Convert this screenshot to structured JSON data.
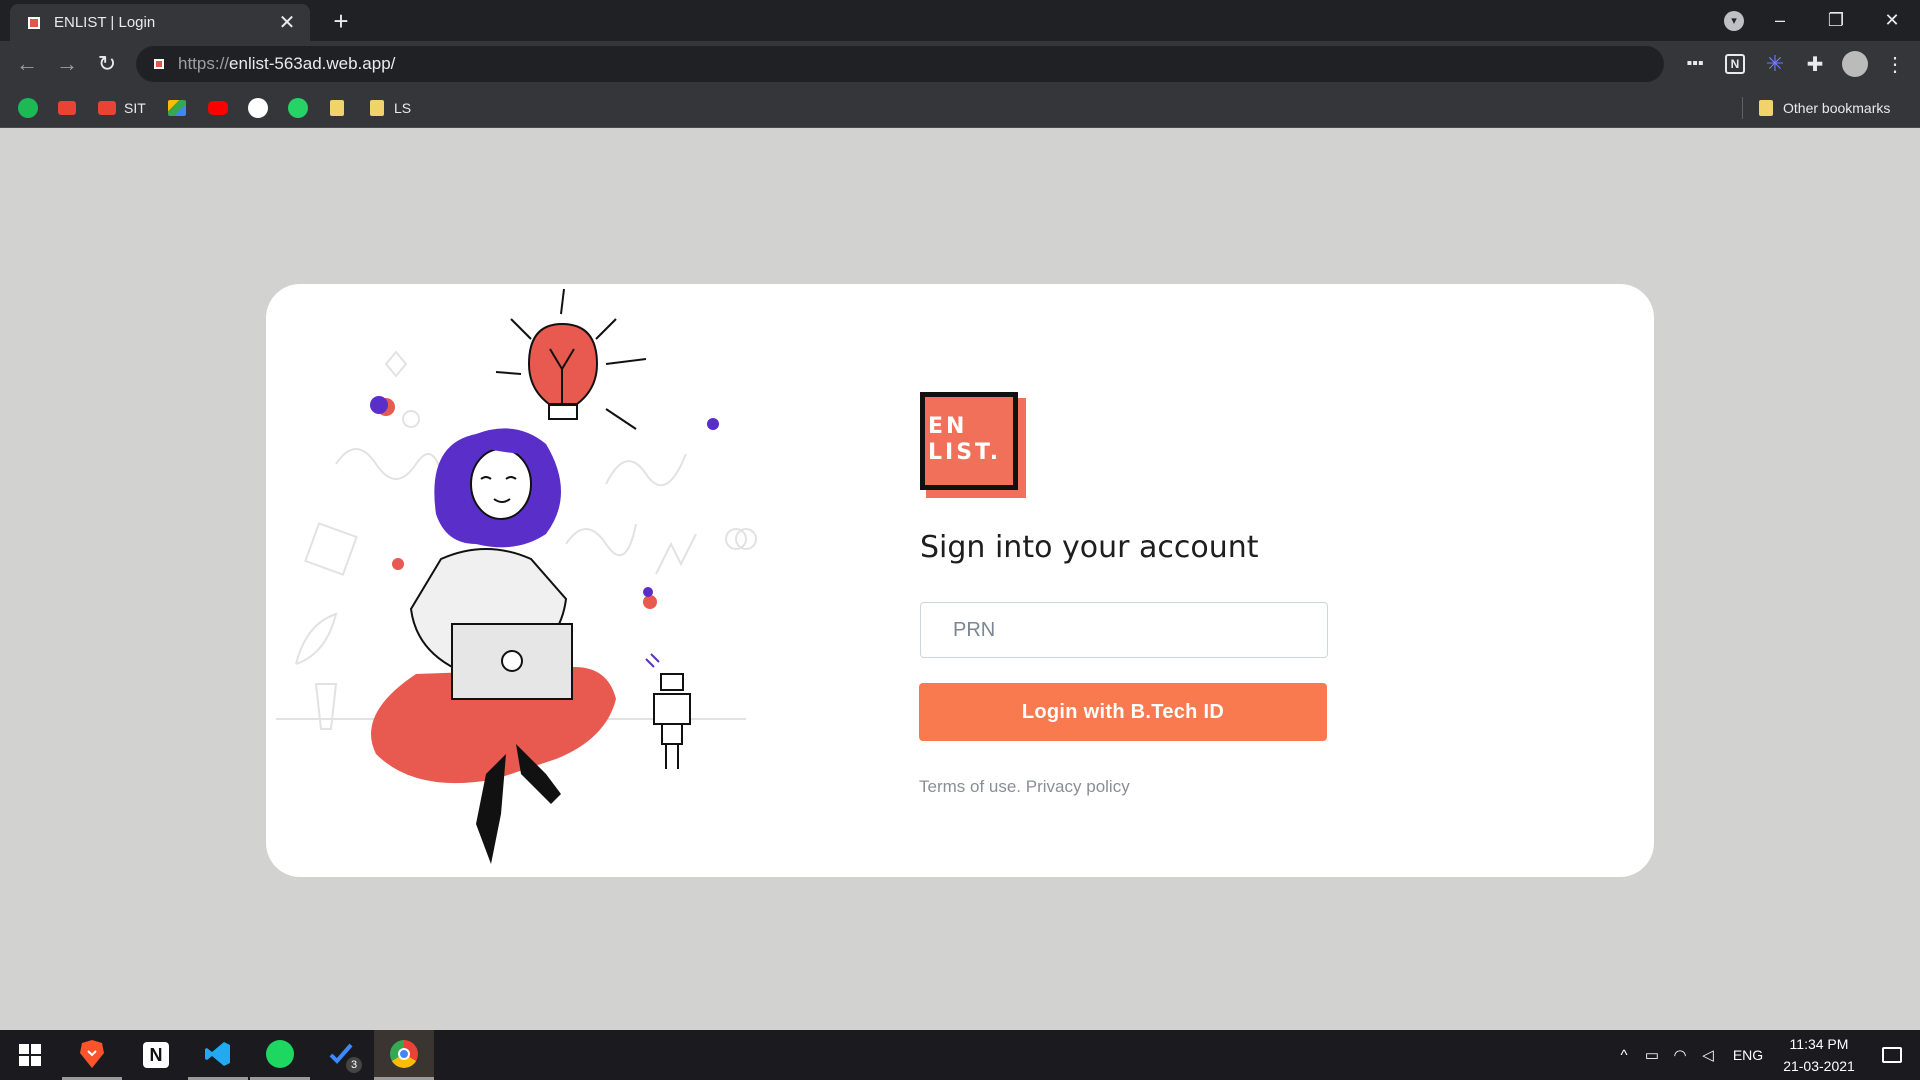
{
  "browser": {
    "tab_title": "ENLIST | Login",
    "tab_close": "✕",
    "new_tab": "+",
    "url_scheme": "https://",
    "url_host": "enlist-563ad.web.app/",
    "window_controls": [
      "–",
      "❐",
      "✕"
    ],
    "bookmarks": [
      {
        "label": "",
        "icon": "spotify-icon"
      },
      {
        "label": "",
        "icon": "gmail-icon"
      },
      {
        "label": "SIT",
        "icon": "gmail-icon"
      },
      {
        "label": "",
        "icon": "google-drive-icon"
      },
      {
        "label": "",
        "icon": "youtube-icon"
      },
      {
        "label": "",
        "icon": "github-icon"
      },
      {
        "label": "",
        "icon": "whatsapp-icon"
      },
      {
        "label": "",
        "icon": "folder-icon"
      },
      {
        "label": "LS",
        "icon": "folder-icon"
      }
    ],
    "other_bookmarks": "Other bookmarks"
  },
  "login": {
    "logo_line1": "EN",
    "logo_line2": "LIST.",
    "heading": "Sign into your account",
    "prn_placeholder": "PRN",
    "login_button": "Login with B.Tech ID",
    "terms": "Terms of use.",
    "privacy": "Privacy policy"
  },
  "taskbar": {
    "apps": [
      "windows-start",
      "brave",
      "notion",
      "vscode",
      "spotify",
      "todo",
      "chrome"
    ],
    "todo_badge": "3",
    "language": "ENG",
    "time": "11:34 PM",
    "date": "21-03-2021"
  },
  "colors": {
    "accent": "#fa7a4f",
    "logo": "#f0705a",
    "illustration_purple": "#5a2fc9",
    "illustration_red": "#e85a4f",
    "page_bg": "#d2d2d0"
  }
}
